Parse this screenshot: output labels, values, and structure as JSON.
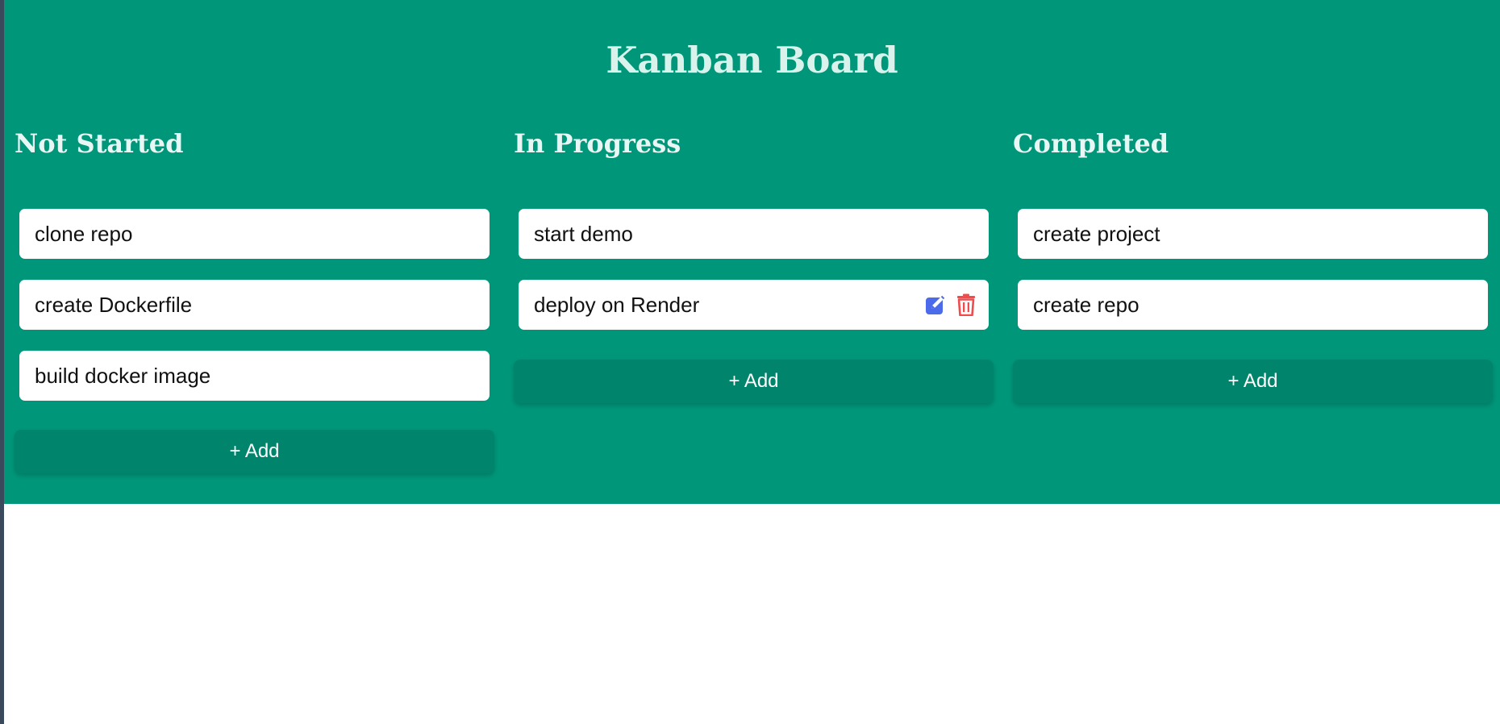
{
  "board": {
    "title": "Kanban Board",
    "background_color": "#00967a",
    "add_button_color": "#00856c"
  },
  "columns": [
    {
      "title": "Not Started",
      "add_label": "+ Add",
      "cards": [
        {
          "text": "clone repo"
        },
        {
          "text": "create Dockerfile"
        },
        {
          "text": "build docker image"
        }
      ]
    },
    {
      "title": "In Progress",
      "add_label": "+ Add",
      "cards": [
        {
          "text": "start demo"
        },
        {
          "text": "deploy on Render",
          "hovered": true
        }
      ]
    },
    {
      "title": "Completed",
      "add_label": "+ Add",
      "cards": [
        {
          "text": "create project"
        },
        {
          "text": "create repo"
        }
      ]
    }
  ],
  "icons": {
    "edit": "edit-icon",
    "delete": "trash-icon",
    "edit_color": "#4b6bea",
    "delete_color": "#f24b4b"
  }
}
